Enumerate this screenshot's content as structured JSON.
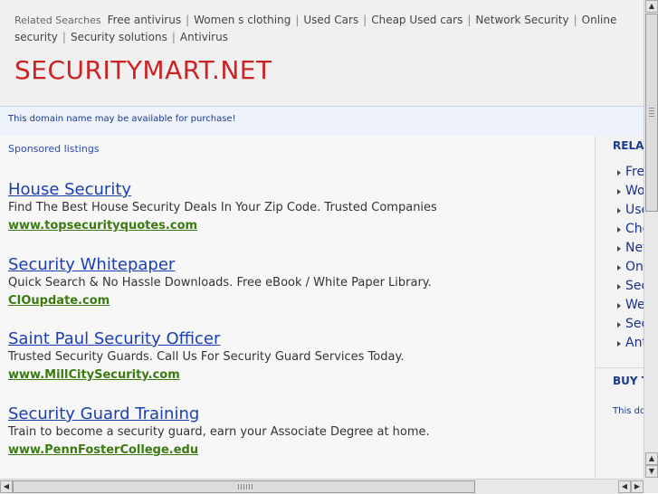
{
  "header": {
    "related_label": "Related Searches",
    "related_links": [
      "Free antivirus",
      "Women s clothing",
      "Used Cars",
      "Cheap Used cars",
      "Network Security",
      "Online security",
      "Security solutions",
      "Antivirus"
    ],
    "site_title": "SECURITYMART.NET"
  },
  "availability": {
    "text": "This domain name may be available for purchase!"
  },
  "main": {
    "sponsored_label": "Sponsored listings",
    "ads": [
      {
        "title": "House Security",
        "description": "Find The Best House Security Deals In Your Zip Code. Trusted Companies",
        "url": "www.topsecurityquotes.com"
      },
      {
        "title": "Security Whitepaper",
        "description": "Quick Search & No Hassle Downloads. Free eBook / White Paper Library.",
        "url": "CIOupdate.com"
      },
      {
        "title": "Saint Paul Security Officer",
        "description": "Trusted Security Guards. Call Us For Security Guard Services Today.",
        "url": "www.MillCitySecurity.com"
      },
      {
        "title": "Security Guard Training",
        "description": "Train to become a security guard, earn your Associate Degree at home.",
        "url": "www.PennFosterCollege.edu"
      }
    ]
  },
  "sidebar": {
    "heading": "RELA",
    "items": [
      "Fre",
      "Wo",
      "Use",
      "Che",
      "Net",
      "Onl",
      "Sec",
      "We",
      "Sec",
      "Ant"
    ],
    "buy_heading": "BUY T",
    "buy_text": "This dor"
  },
  "icons": {
    "scroll_up": "up-arrow-icon",
    "scroll_down": "down-arrow-icon",
    "scroll_left": "left-arrow-icon",
    "scroll_right": "right-arrow-icon"
  },
  "colors": {
    "title_red": "#cc2222",
    "link_blue": "#1a3fb0",
    "url_green": "#3a7a10"
  }
}
